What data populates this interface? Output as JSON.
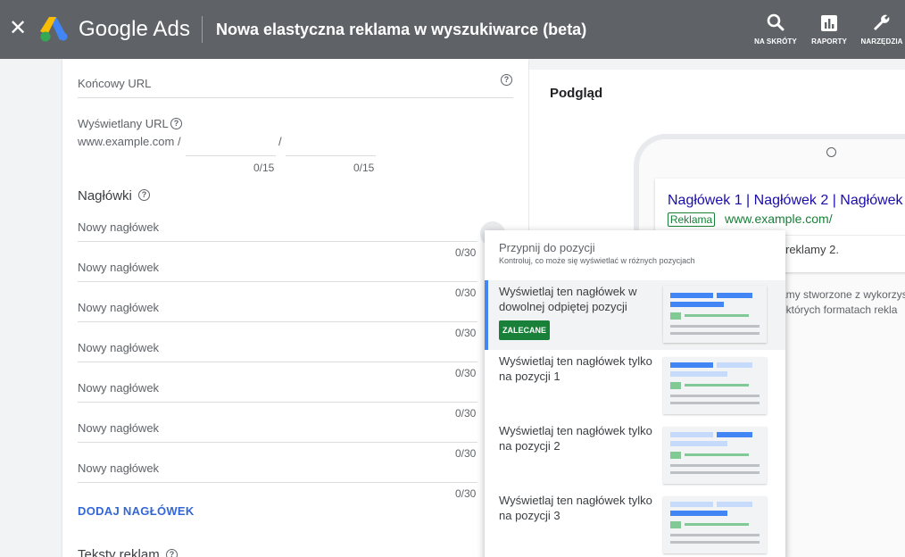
{
  "app": {
    "brand": "Google Ads",
    "page_title": "Nowa elastyczna reklama w wyszukiwarce (beta)",
    "tools": [
      {
        "label": "NA SKRÓTY",
        "icon": "search-icon"
      },
      {
        "label": "RAPORTY",
        "icon": "bar-chart-icon"
      },
      {
        "label": "NARZĘDZIA",
        "icon": "wrench-icon"
      }
    ],
    "colors": {
      "topbar": "#5f6368",
      "link": "#3367d6",
      "recommended": "#188038",
      "headline": "#1a0dab"
    }
  },
  "form": {
    "final_url": {
      "label": "Końcowy URL"
    },
    "display_url": {
      "label": "Wyświetlany URL",
      "domain": "www.example.com /",
      "separator": "/",
      "paths": [
        {
          "counter": "0/15"
        },
        {
          "counter": "0/15"
        }
      ]
    },
    "headlines": {
      "title": "Nagłówki",
      "items": [
        {
          "placeholder": "Nowy nagłówek",
          "counter": "0/30"
        },
        {
          "placeholder": "Nowy nagłówek",
          "counter": "0/30"
        },
        {
          "placeholder": "Nowy nagłówek",
          "counter": "0/30"
        },
        {
          "placeholder": "Nowy nagłówek",
          "counter": "0/30"
        },
        {
          "placeholder": "Nowy nagłówek",
          "counter": "0/30"
        },
        {
          "placeholder": "Nowy nagłówek",
          "counter": "0/30"
        },
        {
          "placeholder": "Nowy nagłówek",
          "counter": "0/30"
        }
      ],
      "add_label": "DODAJ NAGŁÓWEK"
    },
    "descriptions": {
      "title": "Teksty reklam"
    }
  },
  "preview": {
    "title": "Podgląd",
    "ad": {
      "headline": "Nagłówek 1 | Nagłówek 2 | Nagłówek",
      "badge": "Reklama",
      "url": "www.example.com/",
      "description": "reklamy 2."
    },
    "notes": [
      "amy stworzone z wykorzys",
      "ektórych formatach rekla"
    ]
  },
  "pin_menu": {
    "title": "Przypnij do pozycji",
    "subtitle": "Kontroluj, co może się wyświetlać w różnych pozycjach",
    "options": [
      {
        "text": "Wyświetlaj ten nagłówek w dowolnej odpiętej pozycji",
        "badge": "ZALECANE",
        "selected": true
      },
      {
        "text": "Wyświetlaj ten nagłówek tylko na pozycji 1",
        "selected": false
      },
      {
        "text": "Wyświetlaj ten nagłówek tylko na pozycji 2",
        "selected": false
      },
      {
        "text": "Wyświetlaj ten nagłówek tylko na pozycji 3",
        "selected": false
      }
    ]
  }
}
